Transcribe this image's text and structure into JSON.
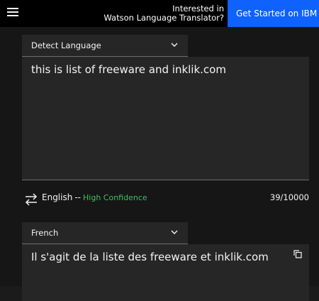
{
  "header": {
    "menu_icon": "hamburger-menu-icon",
    "promo_line1": "Interested in",
    "promo_line2": "Watson Language Translator?",
    "cta_label": "Get Started on IBM Clo",
    "cta_color": "#0f62fe"
  },
  "source": {
    "language": "Detect Language",
    "text": "this is list of freeware and inklik.com",
    "detected_language": "English",
    "separator": "--",
    "confidence": "High Confidence",
    "char_count": "39/10000"
  },
  "target": {
    "language": "French",
    "text": "Il s'agit de la liste des freeware et inklik.com",
    "copy_icon": "copy-icon"
  },
  "colors": {
    "confidence": "#42be65",
    "background": "#161616",
    "field": "#262626"
  }
}
